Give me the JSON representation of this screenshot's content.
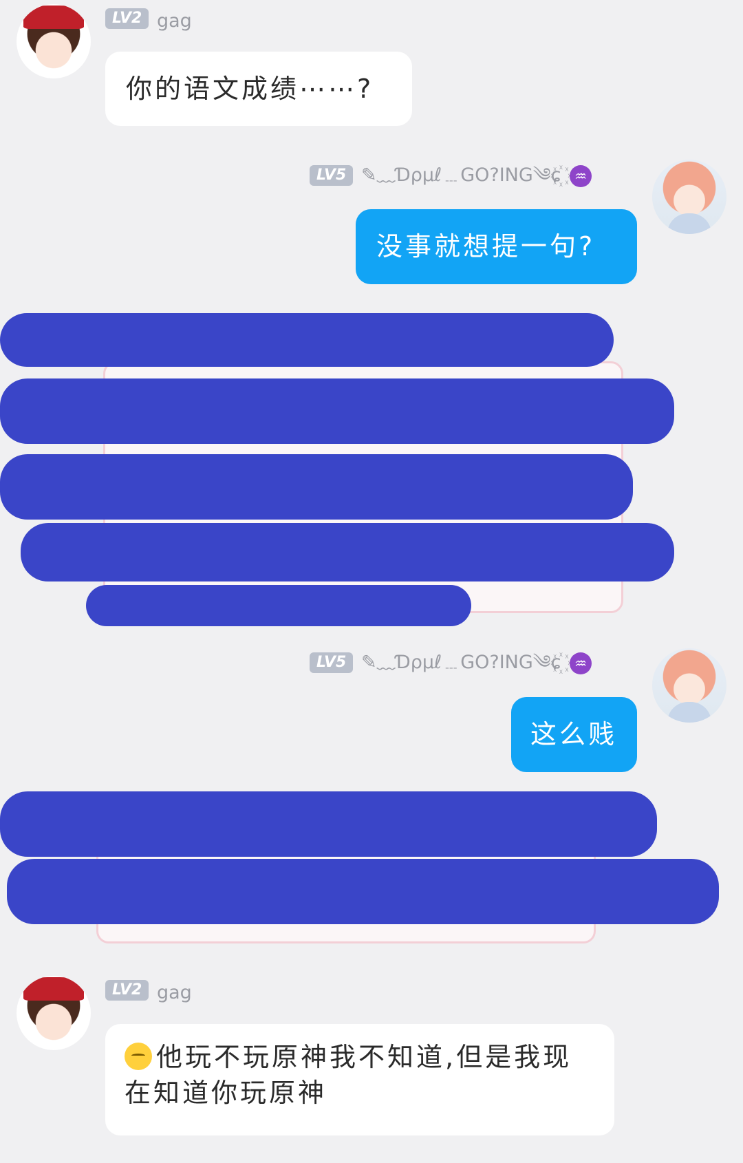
{
  "messages": [
    {
      "sender": "gag",
      "level": "LV2",
      "side": "left",
      "text": "你的语文成绩⋯⋯?"
    },
    {
      "sender": "✎﹏Ɗρμℓ﹍GO?ING༄ɕ꙰",
      "level": "LV5",
      "side": "right",
      "zodiac": "♒",
      "text": "没事就想提一句?"
    },
    {
      "side": "left",
      "redacted": true
    },
    {
      "sender": "✎﹏Ɗρμℓ﹍GO?ING༄ɕ꙰",
      "level": "LV5",
      "side": "right",
      "zodiac": "♒",
      "text": "这么贱"
    },
    {
      "side": "left",
      "redacted": true
    },
    {
      "sender": "gag",
      "level": "LV2",
      "side": "left",
      "emoji": "pensive-emoji",
      "text": "他玩不玩原神我不知道,但是我现在知道你玩原神"
    }
  ],
  "colors": {
    "background": "#f0f0f2",
    "bubble_self": "#12a4f5",
    "bubble_other": "#ffffff",
    "redaction": "#3a45c8",
    "level_badge": "#b9bfcb"
  }
}
